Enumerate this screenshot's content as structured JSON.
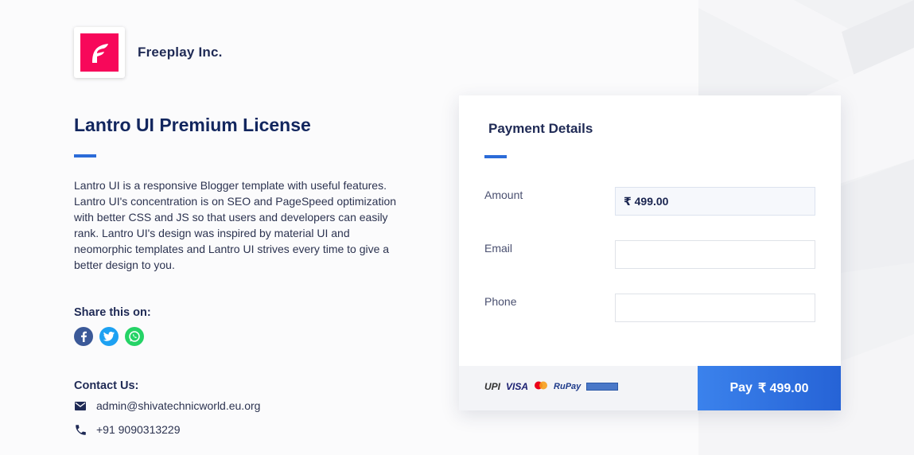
{
  "brand": {
    "name": "Freeplay Inc."
  },
  "product": {
    "title": "Lantro UI Premium License",
    "description": "Lantro UI is a responsive Blogger template with useful features. Lantro UI's concentration is on SEO and PageSpeed optimization with better CSS and JS so that users and developers can easily rank. Lantro UI's design was inspired by material UI and neomorphic templates and Lantro UI strives every time to give a better design to you."
  },
  "share": {
    "label": "Share this on:"
  },
  "contact": {
    "label": "Contact Us:",
    "email": "admin@shivatechnicworld.eu.org",
    "phone": "+91 9090313229"
  },
  "payment": {
    "title": "Payment Details",
    "amount_label": "Amount",
    "amount_value": "₹ 499.00",
    "email_label": "Email",
    "email_value": "",
    "phone_label": "Phone",
    "phone_value": "",
    "methods": {
      "upi": "UPI",
      "visa": "VISA",
      "rupay": "RuPay"
    },
    "pay_label": "Pay",
    "pay_amount": "₹ 499.00"
  },
  "colors": {
    "accent": "#2b6bd8",
    "brand_logo": "#f7085a",
    "facebook": "#3b5998",
    "twitter": "#1da1f2",
    "whatsapp": "#25d366",
    "pay_button": "#2f72e2"
  }
}
